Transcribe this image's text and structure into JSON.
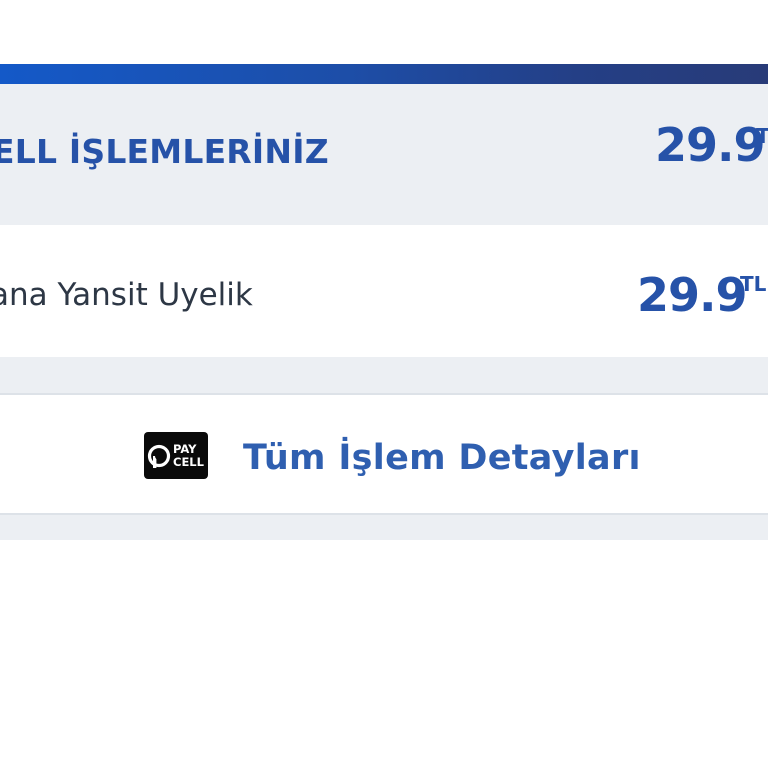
{
  "header": {
    "title": "ELL İŞLEMLERİNİZ",
    "amount": "29.9",
    "currency": "TL"
  },
  "transaction": {
    "label": "ana Yansit Uyelik",
    "amount": "29.9",
    "currency": "TL"
  },
  "details_button": {
    "logo_text_top": "PAY",
    "logo_text_bottom": "CELL",
    "label": "Tüm İşlem Detayları"
  },
  "colors": {
    "brand_blue": "#2652a8",
    "band_gradient_start": "#1459c8",
    "band_gradient_end": "#283b78",
    "row_gray": "#eceff3"
  }
}
